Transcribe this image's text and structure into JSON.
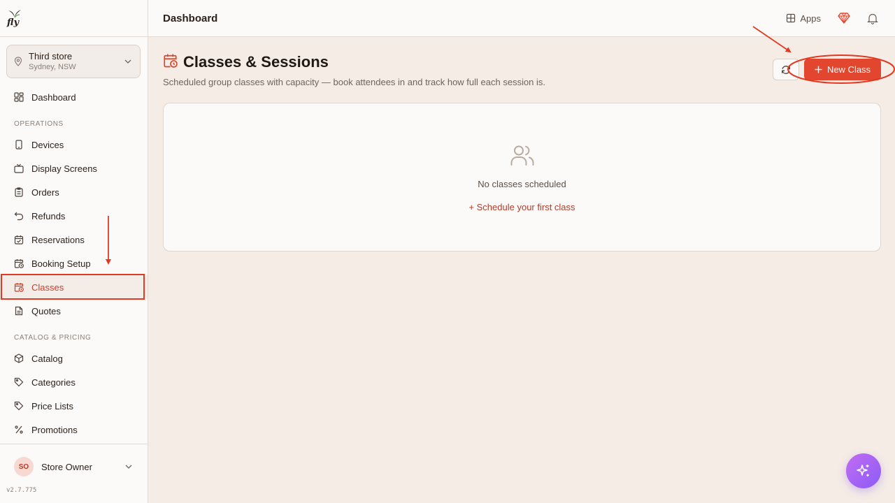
{
  "brand": {
    "logo_text": "fly"
  },
  "store": {
    "name": "Third store",
    "location": "Sydney, NSW"
  },
  "nav": {
    "dashboard": "Dashboard",
    "operations_header": "OPERATIONS",
    "devices": "Devices",
    "display_screens": "Display Screens",
    "orders": "Orders",
    "refunds": "Refunds",
    "reservations": "Reservations",
    "booking_setup": "Booking Setup",
    "classes": "Classes",
    "quotes": "Quotes",
    "catalog_header": "CATALOG & PRICING",
    "catalog": "Catalog",
    "categories": "Categories",
    "price_lists": "Price Lists",
    "promotions": "Promotions"
  },
  "user": {
    "initials": "SO",
    "name": "Store Owner"
  },
  "version": "v2.7.775",
  "topbar": {
    "title": "Dashboard",
    "apps_label": "Apps"
  },
  "page": {
    "title": "Classes & Sessions",
    "subtitle": "Scheduled group classes with capacity — book attendees in and track how full each session is.",
    "new_button": "New Class",
    "empty_text": "No classes scheduled",
    "empty_link": "+ Schedule your first class"
  },
  "colors": {
    "accent": "#e2462e",
    "active_text": "#c2412d",
    "annotation": "#e03a22"
  }
}
